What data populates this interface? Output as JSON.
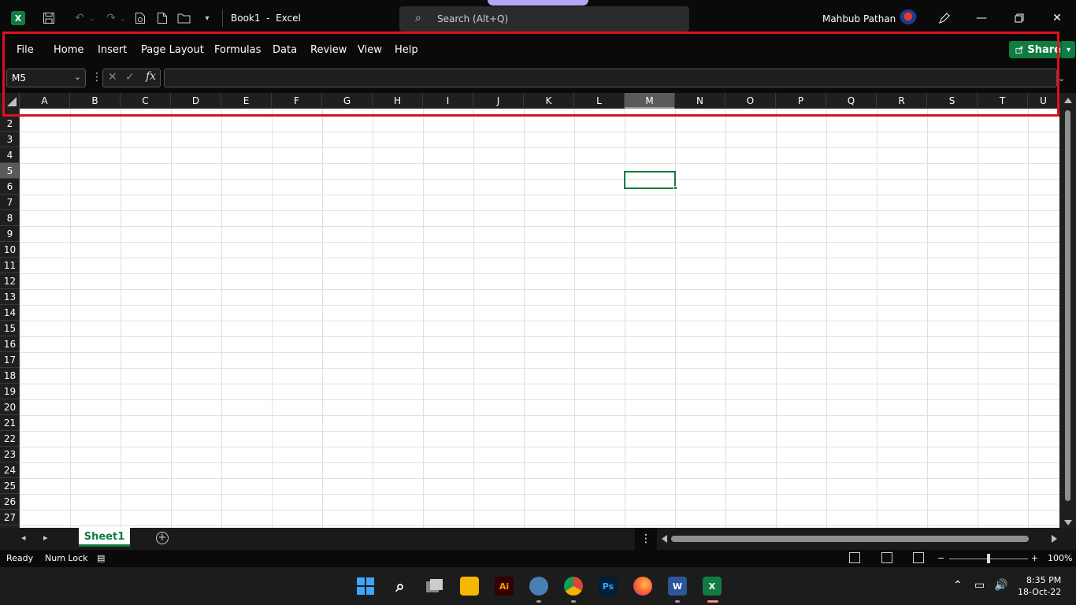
{
  "titlebar": {
    "doc_title": "Book1  -  Excel",
    "search_placeholder": "Search (Alt+Q)",
    "user_name": "Mahbub Pathan",
    "excel_glyph": "X"
  },
  "ribbon": {
    "tabs": [
      "File",
      "Home",
      "Insert",
      "Page Layout",
      "Formulas",
      "Data",
      "Review",
      "View",
      "Help"
    ],
    "share_label": "Share"
  },
  "formula_bar": {
    "name_box": "M5",
    "fx_label": "fx",
    "formula_value": ""
  },
  "sheet": {
    "columns": [
      "A",
      "B",
      "C",
      "D",
      "E",
      "F",
      "G",
      "H",
      "I",
      "J",
      "K",
      "L",
      "M",
      "N",
      "O",
      "P",
      "Q",
      "R",
      "S",
      "T",
      "U"
    ],
    "rows": [
      "2",
      "3",
      "4",
      "5",
      "6",
      "7",
      "8",
      "9",
      "10",
      "11",
      "12",
      "13",
      "14",
      "15",
      "16",
      "17",
      "18",
      "19",
      "20",
      "21",
      "22",
      "23",
      "24",
      "25",
      "26",
      "27"
    ],
    "selected_column": "M",
    "selected_row": "5",
    "tab_name": "Sheet1"
  },
  "status": {
    "ready": "Ready",
    "num_lock": "Num Lock",
    "zoom": "100%"
  },
  "taskbar": {
    "ai_label": "Ai",
    "ps_label": "Ps",
    "word_label": "W",
    "excel_label": "X",
    "time": "8:35 PM",
    "date": "18-Oct-22"
  },
  "colors": {
    "excel_green": "#107c41",
    "highlight_red": "#e0101a"
  }
}
